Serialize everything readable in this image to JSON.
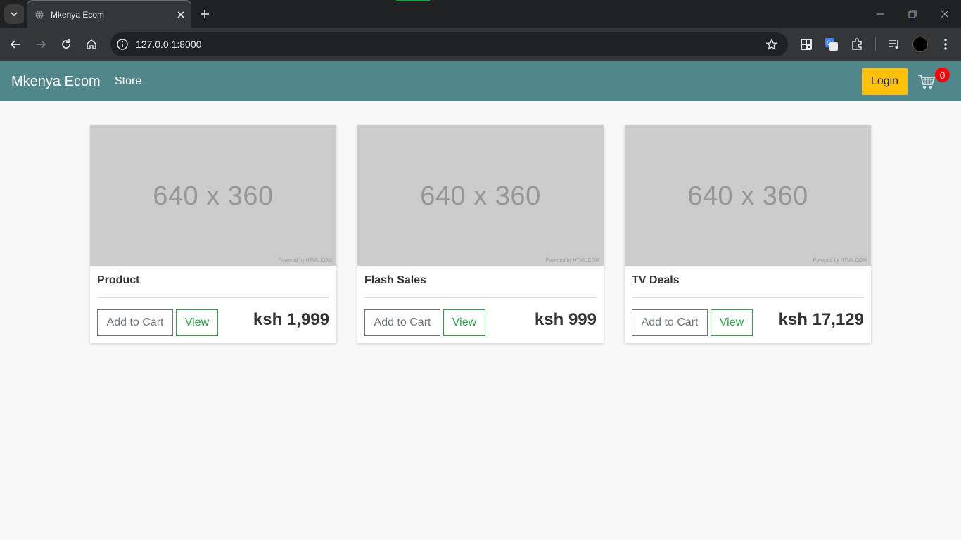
{
  "browser": {
    "tab_title": "Mkenya Ecom",
    "url": "127.0.0.1:8000"
  },
  "site": {
    "brand": "Mkenya Ecom",
    "nav_store": "Store",
    "login_label": "Login",
    "cart_count": "0",
    "colors": {
      "navbar": "#51868b",
      "login": "#ffc107",
      "badge": "#ff0000",
      "view": "#28a745"
    }
  },
  "products": [
    {
      "image_text": "640 x 360",
      "image_credit": "Powered by HTML.COM",
      "name": "Product",
      "add_label": "Add to Cart",
      "view_label": "View",
      "price": "ksh 1,999"
    },
    {
      "image_text": "640 x 360",
      "image_credit": "Powered by HTML.COM",
      "name": "Flash Sales",
      "add_label": "Add to Cart",
      "view_label": "View",
      "price": "ksh 999"
    },
    {
      "image_text": "640 x 360",
      "image_credit": "Powered by HTML.COM",
      "name": "TV Deals",
      "add_label": "Add to Cart",
      "view_label": "View",
      "price": "ksh 17,129"
    }
  ]
}
